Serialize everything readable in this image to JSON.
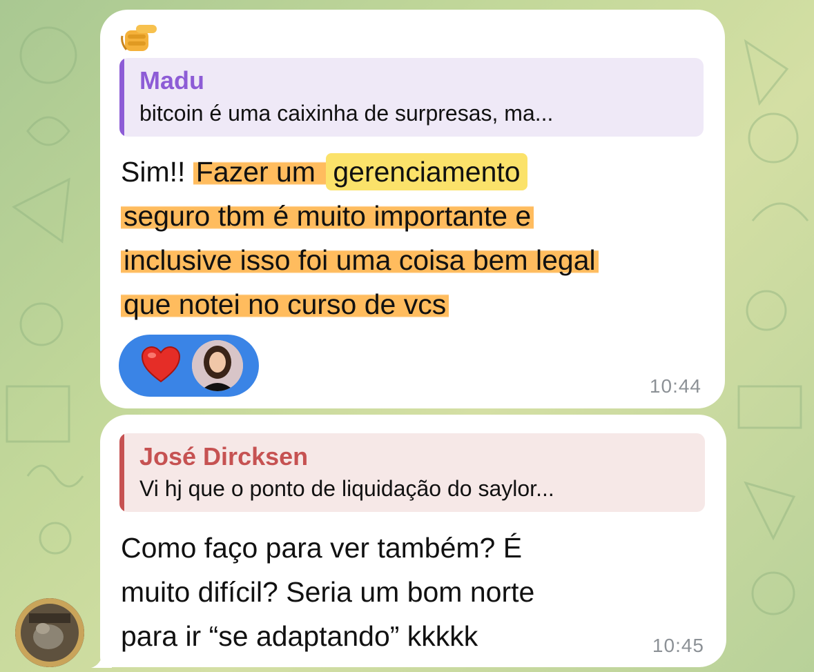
{
  "messages": [
    {
      "reaction_emoji": "pointing-hand",
      "reply": {
        "author": "Madu",
        "snippet": "bitcoin é uma caixinha de surpresas, ma..."
      },
      "text": {
        "line1_plain": "Sim!! ",
        "line1_hl_a": "Fazer um ",
        "line1_hl_b": "gerenciamento",
        "line2": "seguro tbm é muito importante e",
        "line3": "inclusive isso foi uma coisa bem legal",
        "line4": "que notei no curso de vcs"
      },
      "reactions": [
        {
          "emoji": "heart",
          "by": "user-avatar"
        }
      ],
      "time": "10:44"
    },
    {
      "reply": {
        "author": "José Dircksen",
        "snippet": "Vi hj que o ponto de liquidação do saylor..."
      },
      "text": {
        "line1": "Como faço para ver também? É",
        "line2": "muito difícil? Seria um bom norte",
        "line3": "para ir “se adaptando” kkkkk"
      },
      "time": "10:45"
    }
  ],
  "colors": {
    "reply1_accent": "#8d5cd6",
    "reply2_accent": "#c65252",
    "highlight_orange": "#ffb042",
    "highlight_yellow": "#fbe26a",
    "reaction_bg": "#3a84e6",
    "bubble_bg": "#ffffff"
  }
}
